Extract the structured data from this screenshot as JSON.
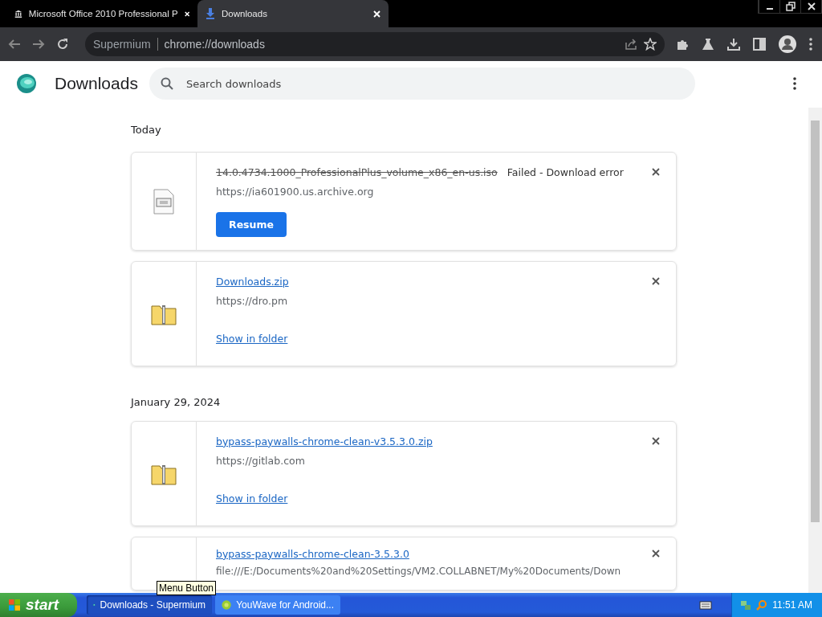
{
  "browser_tabs": [
    {
      "title": "Microsoft Office 2010 Professional P",
      "kind": "museum",
      "selected": false
    },
    {
      "title": "Downloads",
      "kind": "download",
      "selected": true
    }
  ],
  "omnibox": {
    "site": "Supermium",
    "url": "chrome://downloads"
  },
  "page": {
    "title": "Downloads",
    "search": {
      "placeholder": "Search downloads"
    }
  },
  "groups": [
    {
      "date": "Today",
      "items": [
        {
          "kind": "failed",
          "icon": {
            "kind": "document"
          },
          "name": "14.0.4734.1000_ProfessionalPlus_volume_x86_en-us.iso",
          "status": "Failed - Download error",
          "url": "https://ia601900.us.archive.org",
          "action": "Resume"
        },
        {
          "kind": "complete",
          "icon": {
            "kind": "zip"
          },
          "name": "Downloads.zip",
          "url": "https://dro.pm",
          "action": "Show in folder"
        }
      ]
    },
    {
      "date": "January 29, 2024",
      "items": [
        {
          "kind": "complete",
          "icon": {
            "kind": "zip"
          },
          "name": "bypass-paywalls-chrome-clean-v3.5.3.0.zip",
          "url": "https://gitlab.com",
          "action": "Show in folder"
        },
        {
          "kind": "complete",
          "name": "bypass-paywalls-chrome-clean-3.5.3.0",
          "url": "file:///E:/Documents%20and%20Settings/VM2.COLLABNET/My%20Documents/Down"
        }
      ]
    }
  ],
  "tooltip": "Menu Button",
  "taskbar": {
    "start": "start",
    "tasks": [
      {
        "label": "Downloads - Supermium",
        "selected": true
      },
      {
        "label": "YouWave for Android...",
        "selected": false
      }
    ],
    "clock": "11:51 AM"
  }
}
